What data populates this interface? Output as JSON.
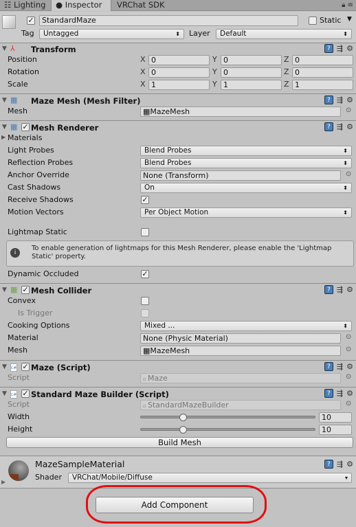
{
  "tabs": [
    {
      "label": "Lighting",
      "icon": "lighting-icon"
    },
    {
      "label": "Inspector",
      "icon": "info-icon",
      "active": true
    },
    {
      "label": "VRChat SDK"
    }
  ],
  "object": {
    "name": "StandardMaze",
    "active": true,
    "static_label": "Static",
    "static": false,
    "tag_label": "Tag",
    "tag": "Untagged",
    "layer_label": "Layer",
    "layer": "Default"
  },
  "transform": {
    "title": "Transform",
    "rows": [
      {
        "label": "Position",
        "x": "0",
        "y": "0",
        "z": "0"
      },
      {
        "label": "Rotation",
        "x": "0",
        "y": "0",
        "z": "0"
      },
      {
        "label": "Scale",
        "x": "1",
        "y": "1",
        "z": "1"
      }
    ],
    "axes": [
      "X",
      "Y",
      "Z"
    ]
  },
  "mesh_filter": {
    "title": "Maze Mesh (Mesh Filter)",
    "mesh_label": "Mesh",
    "mesh": "MazeMesh"
  },
  "mesh_renderer": {
    "title": "Mesh Renderer",
    "enabled": true,
    "materials": "Materials",
    "light_probes_label": "Light Probes",
    "light_probes": "Blend Probes",
    "reflection_probes_label": "Reflection Probes",
    "reflection_probes": "Blend Probes",
    "anchor_label": "Anchor Override",
    "anchor": "None (Transform)",
    "cast_label": "Cast Shadows",
    "cast": "On",
    "receive_label": "Receive Shadows",
    "receive": true,
    "motion_label": "Motion Vectors",
    "motion": "Per Object Motion",
    "lightmap_label": "Lightmap Static",
    "lightmap": false,
    "help_line1": "To enable generation of lightmaps for this Mesh Renderer, please enable the 'Lightmap",
    "help_line2": "Static' property.",
    "occluded_label": "Dynamic Occluded",
    "occluded": true
  },
  "mesh_collider": {
    "title": "Mesh Collider",
    "enabled": true,
    "convex_label": "Convex",
    "convex": false,
    "trigger_label": "Is Trigger",
    "trigger": false,
    "cooking_label": "Cooking Options",
    "cooking": "Mixed ...",
    "material_label": "Material",
    "material": "None (Physic Material)",
    "mesh_label": "Mesh",
    "mesh": "MazeMesh"
  },
  "maze_script": {
    "title": "Maze (Script)",
    "enabled": true,
    "script_label": "Script",
    "script": "Maze"
  },
  "builder": {
    "title": "Standard Maze Builder (Script)",
    "enabled": true,
    "script_label": "Script",
    "script": "StandardMazeBuilder",
    "width_label": "Width",
    "width": "10",
    "height_label": "Height",
    "height": "10",
    "build_button": "Build Mesh"
  },
  "material": {
    "name": "MazeSampleMaterial",
    "shader_label": "Shader",
    "shader": "VRChat/Mobile/Diffuse"
  },
  "add_component": "Add Component",
  "colors": {
    "annotation": "#e01010",
    "help_icon": "#4a7fb8"
  }
}
